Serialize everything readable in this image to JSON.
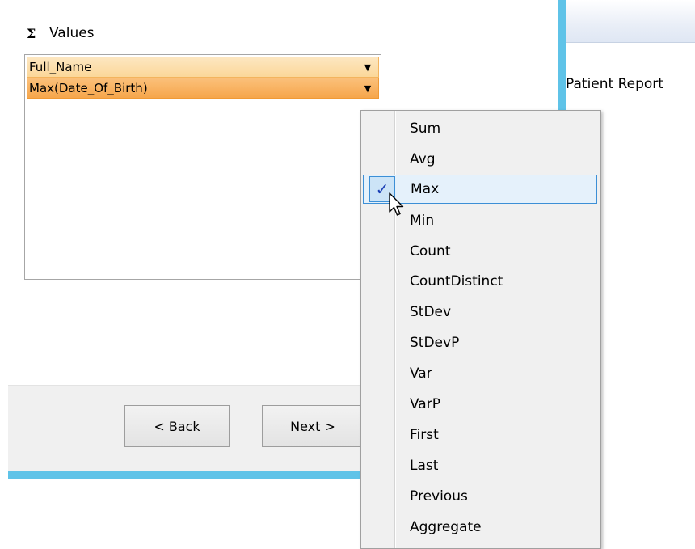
{
  "values_panel": {
    "sigma_glyph": "Σ",
    "label": "Values",
    "rows": [
      {
        "text": "Full_Name",
        "arrow": "▼"
      },
      {
        "text": "Max(Date_Of_Birth)",
        "arrow": "▼"
      }
    ]
  },
  "footer": {
    "back_label": "< Back",
    "next_label": "Next >"
  },
  "right_window": {
    "title": "Patient Report"
  },
  "aggregate_menu": {
    "checkmark": "✓",
    "selected": "Max",
    "items": [
      "Sum",
      "Avg",
      "Max",
      "Min",
      "Count",
      "CountDistinct",
      "StDev",
      "StDevP",
      "Var",
      "VarP",
      "First",
      "Last",
      "Previous",
      "Aggregate"
    ]
  },
  "colors": {
    "accent_border": "#5fc3e8",
    "row_highlight": "#f6a64b",
    "row_light": "#fbd799",
    "menu_selection_border": "#3c8fd6",
    "menu_selection_fill": "#e5f1fb",
    "checkmark": "#1a3fb5"
  }
}
